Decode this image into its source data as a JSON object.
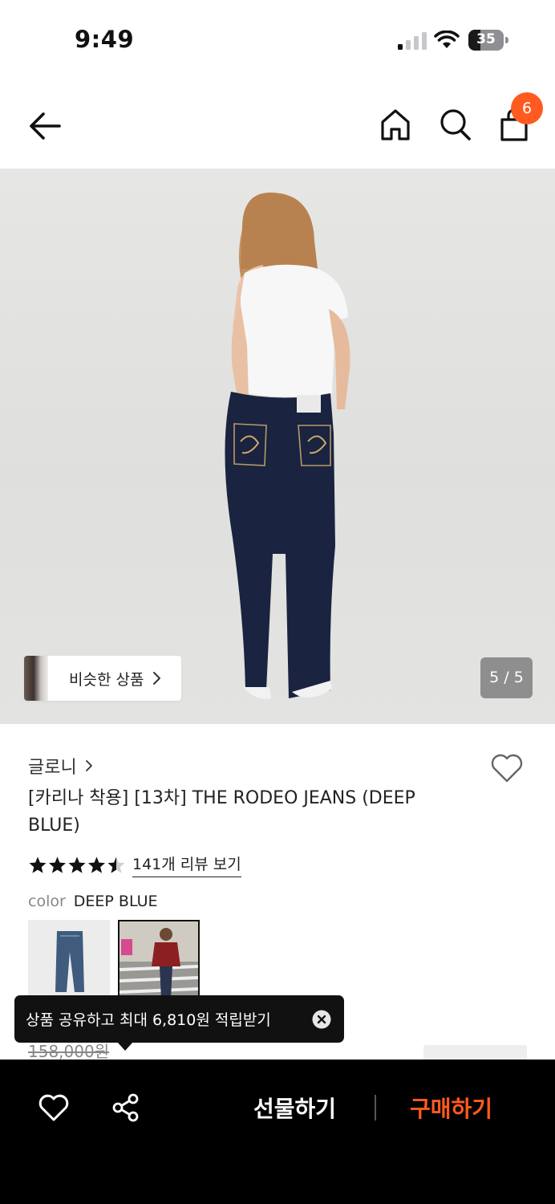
{
  "status_bar": {
    "time": "9:49",
    "battery": "35",
    "battery_level": 0.35
  },
  "nav": {
    "cart_count": "6"
  },
  "gallery": {
    "similar_label": "비슷한 상품",
    "counter": "5 / 5",
    "current_image": 5,
    "total_images": 5
  },
  "product": {
    "brand": "글로니",
    "title": "[카리나 착용] [13차] THE RODEO JEANS (DEEP BLUE)",
    "rating": 4.5,
    "reviews_label": "141개 리뷰 보기",
    "color_key": "color",
    "color_value": "DEEP BLUE",
    "original_price": "158,000원"
  },
  "tooltip": {
    "message": "상품 공유하고 최대 6,810원 적립받기"
  },
  "bottom_bar": {
    "gift_label": "선물하기",
    "buy_label": "구매하기"
  },
  "colors": {
    "accent": "#ff5a1f",
    "bottom_bar_bg": "#000000",
    "tooltip_bg": "#111111"
  },
  "icons": [
    "back-arrow-icon",
    "home-icon",
    "search-icon",
    "shopping-bag-icon",
    "chevron-right-icon",
    "heart-icon",
    "star-icon",
    "close-icon",
    "share-icon"
  ]
}
